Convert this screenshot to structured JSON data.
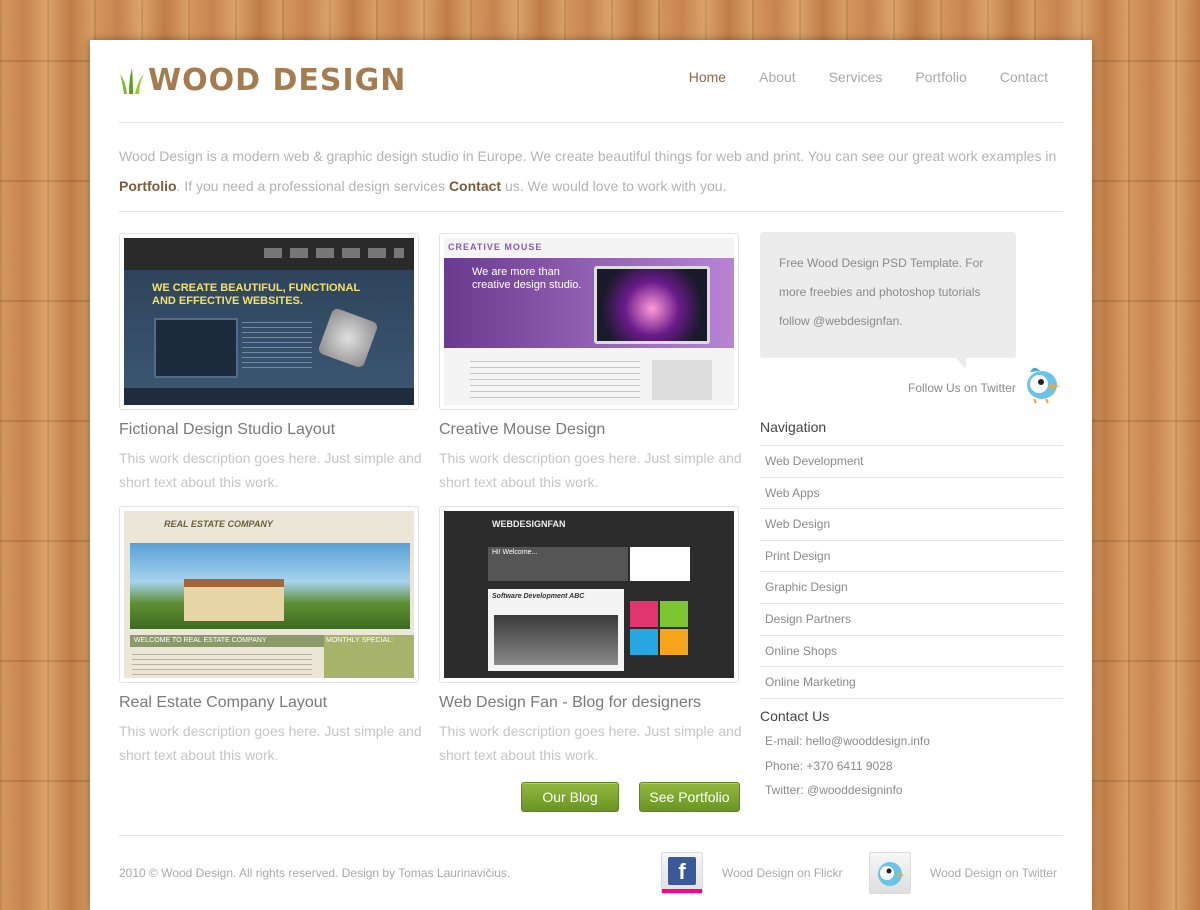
{
  "header": {
    "logo_text": "Wood Design",
    "nav": [
      "Home",
      "About",
      "Services",
      "Portfolio",
      "Contact"
    ]
  },
  "intro": {
    "part1": "Wood Design is a modern web & graphic design studio in Europe. We create beautiful things for web and print. You can see our great work examples in",
    "link1": "Portfolio",
    "part2": ". If you need a professional design services",
    "link2": "Contact",
    "part3": "us. We would love to work with you."
  },
  "works": [
    {
      "title": "Fictional Design Studio Layout",
      "desc": "This work description goes here. Just simple and short text about this work."
    },
    {
      "title": "Creative Mouse Design",
      "desc": "This work description goes here. Just simple and short text about this work."
    },
    {
      "title": "Real Estate Company Layout",
      "desc": "This work description goes here. Just simple and short text about this work."
    },
    {
      "title": "Web Design Fan - Blog for designers",
      "desc": "This work description goes here. Just simple and short text about this work."
    }
  ],
  "thumbs": {
    "t1_headline": "WE CREATE BEAUTIFUL, FUNCTIONAL AND EFFECTIVE WEBSITES.",
    "t2_headline": "We are more than creative design studio.",
    "t2_brand": "CREATIVE MOUSE",
    "t3_brand": "REAL ESTATE COMPANY",
    "t3_banner": "WELCOME TO REAL ESTATE COMPANY",
    "t3_special": "MONTHLY SPECIAL:",
    "t4_brand": "WEBDESIGNFAN",
    "t4_welcome": "Hi! Welcome...",
    "t4_post": "Software Development ABC"
  },
  "buttons": {
    "blog": "Our Blog",
    "portfolio": "See Portfolio"
  },
  "sidebar": {
    "bubble": "Free Wood Design PSD Template. For more freebies and photoshop tutorials follow @webdesignfan.",
    "follow": "Follow Us on Twitter",
    "nav_heading": "Navigation",
    "nav_items": [
      "Web Development",
      "Web Apps",
      "Web Design",
      "Print Design",
      "Graphic Design",
      "Design Partners",
      "Online Shops",
      "Online Marketing"
    ],
    "contact_heading": "Contact Us",
    "contact": [
      "E-mail: hello@wooddesign.info",
      "Phone: +370 6411 9028",
      "Twitter: @wooddesigninfo"
    ]
  },
  "footer": {
    "copyright": "2010 © Wood Design. All rights reserved. Design by Tomas Laurinavičius.",
    "flickr": "Wood Design on Flickr",
    "twitter": "Wood Design on Twitter"
  },
  "colors": {
    "accent_brown": "#a57c4f",
    "button_green": "#7aa530",
    "wood": "#c98a52"
  }
}
